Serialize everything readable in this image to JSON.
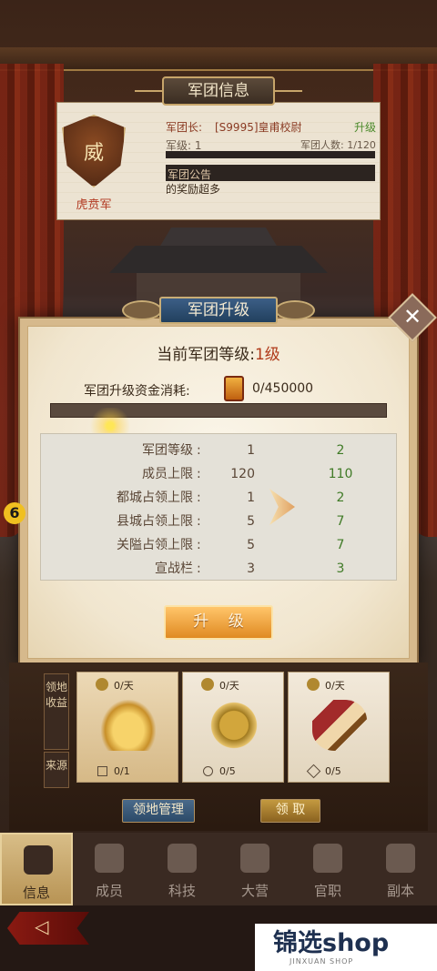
{
  "colors": {
    "accent_gold": "#e0a040",
    "next_value_green": "#3f7a26",
    "level_red": "#b03a1a"
  },
  "legion_info": {
    "title": "军团信息",
    "emblem_char": "威",
    "emblem_name": "虎贲军",
    "leader_label": "军团长:",
    "leader_name": "[S9995]皇甫校尉",
    "upgrade_link": "升级",
    "level_text": "军级: 1",
    "members_text": "军团人数: 1/120",
    "notice_label": "军团公告",
    "notice_text": "的奖励超多"
  },
  "upgrade_modal": {
    "header": "军团升级",
    "close_icon": "close-icon",
    "current_level_label": "当前军团等级:",
    "current_level_value": "1级",
    "cost_label": "军团升级资金消耗:",
    "cost_value": "0/450000",
    "progress": 0,
    "stats": [
      {
        "name": "军团等级",
        "current": "1",
        "next": "2"
      },
      {
        "name": "成员上限",
        "current": "120",
        "next": "110"
      },
      {
        "name": "都城占领上限",
        "current": "1",
        "next": "2"
      },
      {
        "name": "县城占领上限",
        "current": "5",
        "next": "7"
      },
      {
        "name": "关隘占领上限",
        "current": "5",
        "next": "7"
      },
      {
        "name": "宣战栏",
        "current": "3",
        "next": "3"
      }
    ],
    "upgrade_button": "升 级"
  },
  "territory": {
    "side_income": "领地收益",
    "side_source": "来源",
    "cards": [
      {
        "rate": "0/天",
        "count": "0/1",
        "icon": "gold-ingot-icon"
      },
      {
        "rate": "0/天",
        "count": "0/5",
        "icon": "copper-coin-icon"
      },
      {
        "rate": "0/天",
        "count": "0/5",
        "icon": "horn-icon"
      }
    ],
    "manage_button": "领地管理",
    "claim_button": "领 取"
  },
  "side_badge": "6",
  "nav": [
    {
      "label": "信息",
      "icon": "info-icon",
      "active": true
    },
    {
      "label": "成员",
      "icon": "members-icon",
      "active": false
    },
    {
      "label": "科技",
      "icon": "tech-icon",
      "active": false
    },
    {
      "label": "大营",
      "icon": "camp-icon",
      "active": false
    },
    {
      "label": "官职",
      "icon": "official-icon",
      "active": false
    },
    {
      "label": "副本",
      "icon": "dungeon-icon",
      "active": false
    }
  ],
  "watermark": {
    "main": "锦选shop",
    "sub": "JINXUAN SHOP"
  }
}
